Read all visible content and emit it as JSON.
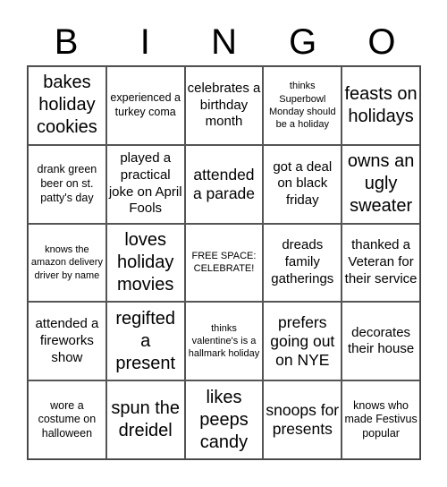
{
  "header": [
    "B",
    "I",
    "N",
    "G",
    "O"
  ],
  "cells": [
    {
      "text": "bakes holiday cookies",
      "size": "s-xl"
    },
    {
      "text": "experienced a turkey coma",
      "size": "s-s"
    },
    {
      "text": "celebrates a birthday month",
      "size": "s-m"
    },
    {
      "text": "thinks Superbowl Monday should be a holiday",
      "size": "s-xs"
    },
    {
      "text": "feasts on holidays",
      "size": "s-xl"
    },
    {
      "text": "drank green beer on st. patty's day",
      "size": "s-s"
    },
    {
      "text": "played a practical joke on April Fools",
      "size": "s-m"
    },
    {
      "text": "attended a parade",
      "size": "s-l"
    },
    {
      "text": "got a deal on black friday",
      "size": "s-m"
    },
    {
      "text": "owns an ugly sweater",
      "size": "s-xl"
    },
    {
      "text": "knows the amazon delivery driver by name",
      "size": "s-xs"
    },
    {
      "text": "loves holiday movies",
      "size": "s-xl"
    },
    {
      "text": "FREE SPACE: CELEBRATE!",
      "size": "s-xs"
    },
    {
      "text": "dreads family gatherings",
      "size": "s-m"
    },
    {
      "text": "thanked a Veteran for their service",
      "size": "s-m"
    },
    {
      "text": "attended a fireworks show",
      "size": "s-m"
    },
    {
      "text": "regifted a present",
      "size": "s-xl"
    },
    {
      "text": "thinks valentine's is a hallmark holiday",
      "size": "s-xs"
    },
    {
      "text": "prefers going out on NYE",
      "size": "s-l"
    },
    {
      "text": "decorates their house",
      "size": "s-m"
    },
    {
      "text": "wore a costume on halloween",
      "size": "s-s"
    },
    {
      "text": "spun the dreidel",
      "size": "s-xl"
    },
    {
      "text": "likes peeps candy",
      "size": "s-xl"
    },
    {
      "text": "snoops for presents",
      "size": "s-l"
    },
    {
      "text": "knows who made Festivus popular",
      "size": "s-s"
    }
  ]
}
